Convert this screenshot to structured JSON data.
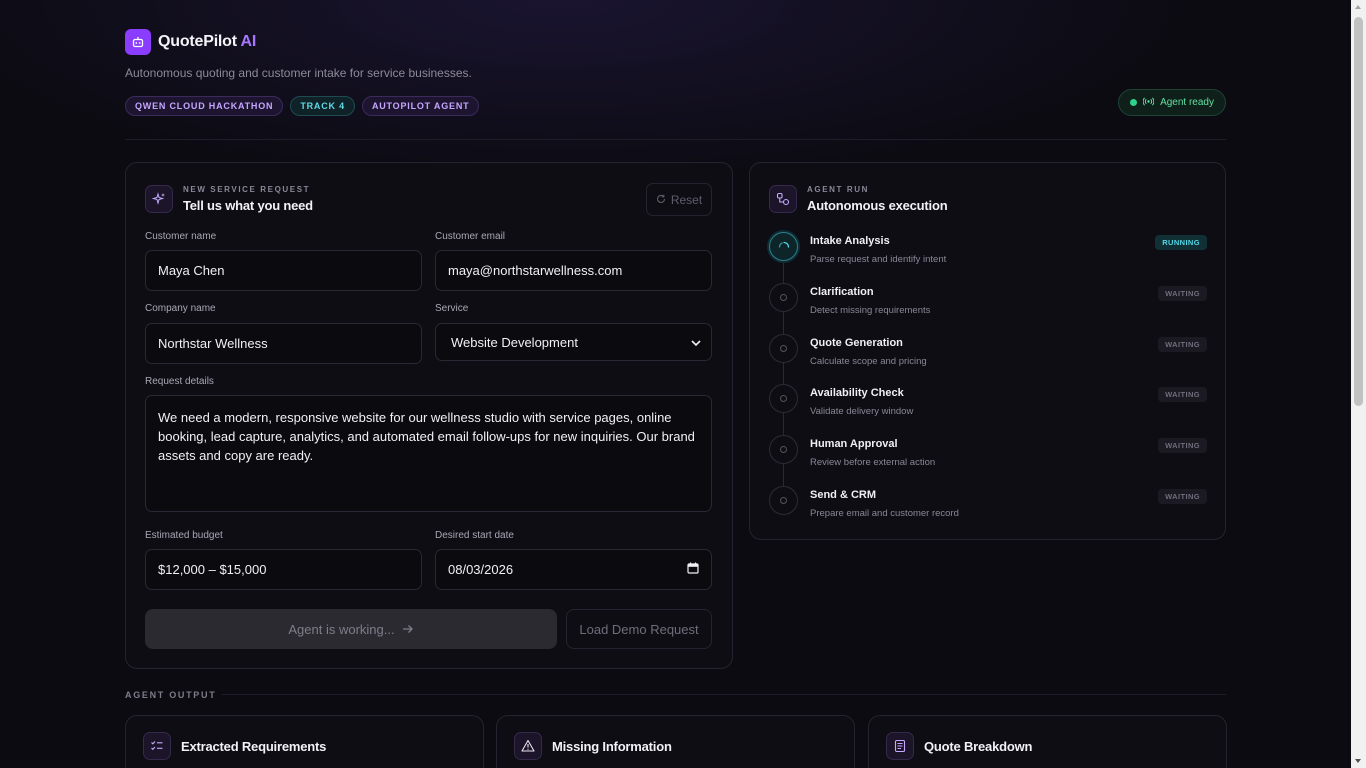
{
  "brand": {
    "name": "QuotePilot",
    "suffix": "AI",
    "tagline": "Autonomous quoting and customer intake for service businesses."
  },
  "badges": [
    "QWEN CLOUD HACKATHON",
    "TRACK 4",
    "AUTOPILOT AGENT"
  ],
  "agent_status": {
    "label": "Agent ready",
    "color": "#2fd28a"
  },
  "form": {
    "eyebrow": "NEW SERVICE REQUEST",
    "title": "Tell us what you need",
    "reset_label": "Reset",
    "customer_name_label": "Customer name",
    "customer_name_value": "Maya Chen",
    "customer_email_label": "Customer email",
    "customer_email_value": "maya@northstarwellness.com",
    "company_label": "Company name",
    "company_value": "Northstar Wellness",
    "service_label": "Service",
    "service_value": "Website Development",
    "details_label": "Request details",
    "details_value": "We need a modern, responsive website for our wellness studio with service pages, online booking, lead capture, analytics, and automated email follow-ups for new inquiries. Our brand assets and copy are ready.",
    "budget_label": "Estimated budget",
    "budget_value": "$12,000 – $15,000",
    "date_label": "Desired start date",
    "date_value": "08/03/2026",
    "submit_label": "Agent is working...",
    "demo_label": "Load Demo Request"
  },
  "run": {
    "eyebrow": "AGENT RUN",
    "title": "Autonomous execution",
    "steps": [
      {
        "name": "Intake Analysis",
        "desc": "Parse request and identify intent",
        "status": "RUNNING"
      },
      {
        "name": "Clarification",
        "desc": "Detect missing requirements",
        "status": "WAITING"
      },
      {
        "name": "Quote Generation",
        "desc": "Calculate scope and pricing",
        "status": "WAITING"
      },
      {
        "name": "Availability Check",
        "desc": "Validate delivery window",
        "status": "WAITING"
      },
      {
        "name": "Human Approval",
        "desc": "Review before external action",
        "status": "WAITING"
      },
      {
        "name": "Send & CRM",
        "desc": "Prepare email and customer record",
        "status": "WAITING"
      }
    ]
  },
  "output": {
    "label": "AGENT OUTPUT",
    "cards": [
      {
        "title": "Extracted Requirements",
        "icon": "checklist-icon"
      },
      {
        "title": "Missing Information",
        "icon": "warning-icon"
      },
      {
        "title": "Quote Breakdown",
        "icon": "document-icon"
      }
    ]
  },
  "colors": {
    "accent": "#8b3dff",
    "accent_text": "#a877ff",
    "running": "#54d7e6",
    "ready": "#5fe0a2"
  }
}
